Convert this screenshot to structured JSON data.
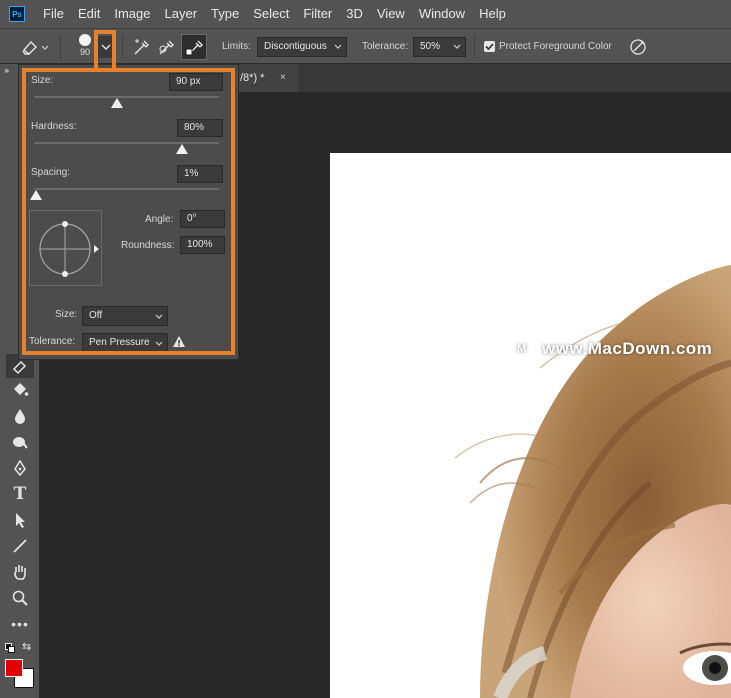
{
  "app": {
    "logo_text": "Ps"
  },
  "menu": [
    "File",
    "Edit",
    "Image",
    "Layer",
    "Type",
    "Select",
    "Filter",
    "3D",
    "View",
    "Window",
    "Help"
  ],
  "options": {
    "brush_size_value": "90",
    "limits_label": "Limits:",
    "limits_value": "Discontiguous",
    "tolerance_label": "Tolerance:",
    "tolerance_value": "50%",
    "protect_label": "Protect Foreground Color",
    "protect_checked": true
  },
  "document_tab": {
    "title": "/8*) *",
    "close_glyph": "×"
  },
  "brush_popup": {
    "size_label": "Size:",
    "size_value": "90 px",
    "size_fraction": 0.45,
    "hardness_label": "Hardness:",
    "hardness_value": "80%",
    "hardness_fraction": 0.8,
    "spacing_label": "Spacing:",
    "spacing_value": "1%",
    "spacing_fraction": 0.01,
    "angle_label": "Angle:",
    "angle_value": "0°",
    "roundness_label": "Roundness:",
    "roundness_value": "100%",
    "size_control_label": "Size:",
    "size_control_value": "Off",
    "tolerance_label": "Tolerance:",
    "tolerance_value": "Pen Pressure"
  },
  "watermark": {
    "text": "www.MacDown.com"
  },
  "colors": {
    "highlight": "#e8812c",
    "foreground": "#e00000",
    "background": "#ffffff",
    "panel": "#4c4c4c",
    "chrome": "#535353"
  },
  "icons": {
    "tool_rows": [
      "eraser-icon",
      "paint-bucket-icon",
      "blur-drop-icon",
      "smudge-icon",
      "pen-icon",
      "type-icon",
      "selection-arrow-icon",
      "line-icon",
      "hand-icon",
      "zoom-icon",
      "more-icon"
    ]
  }
}
